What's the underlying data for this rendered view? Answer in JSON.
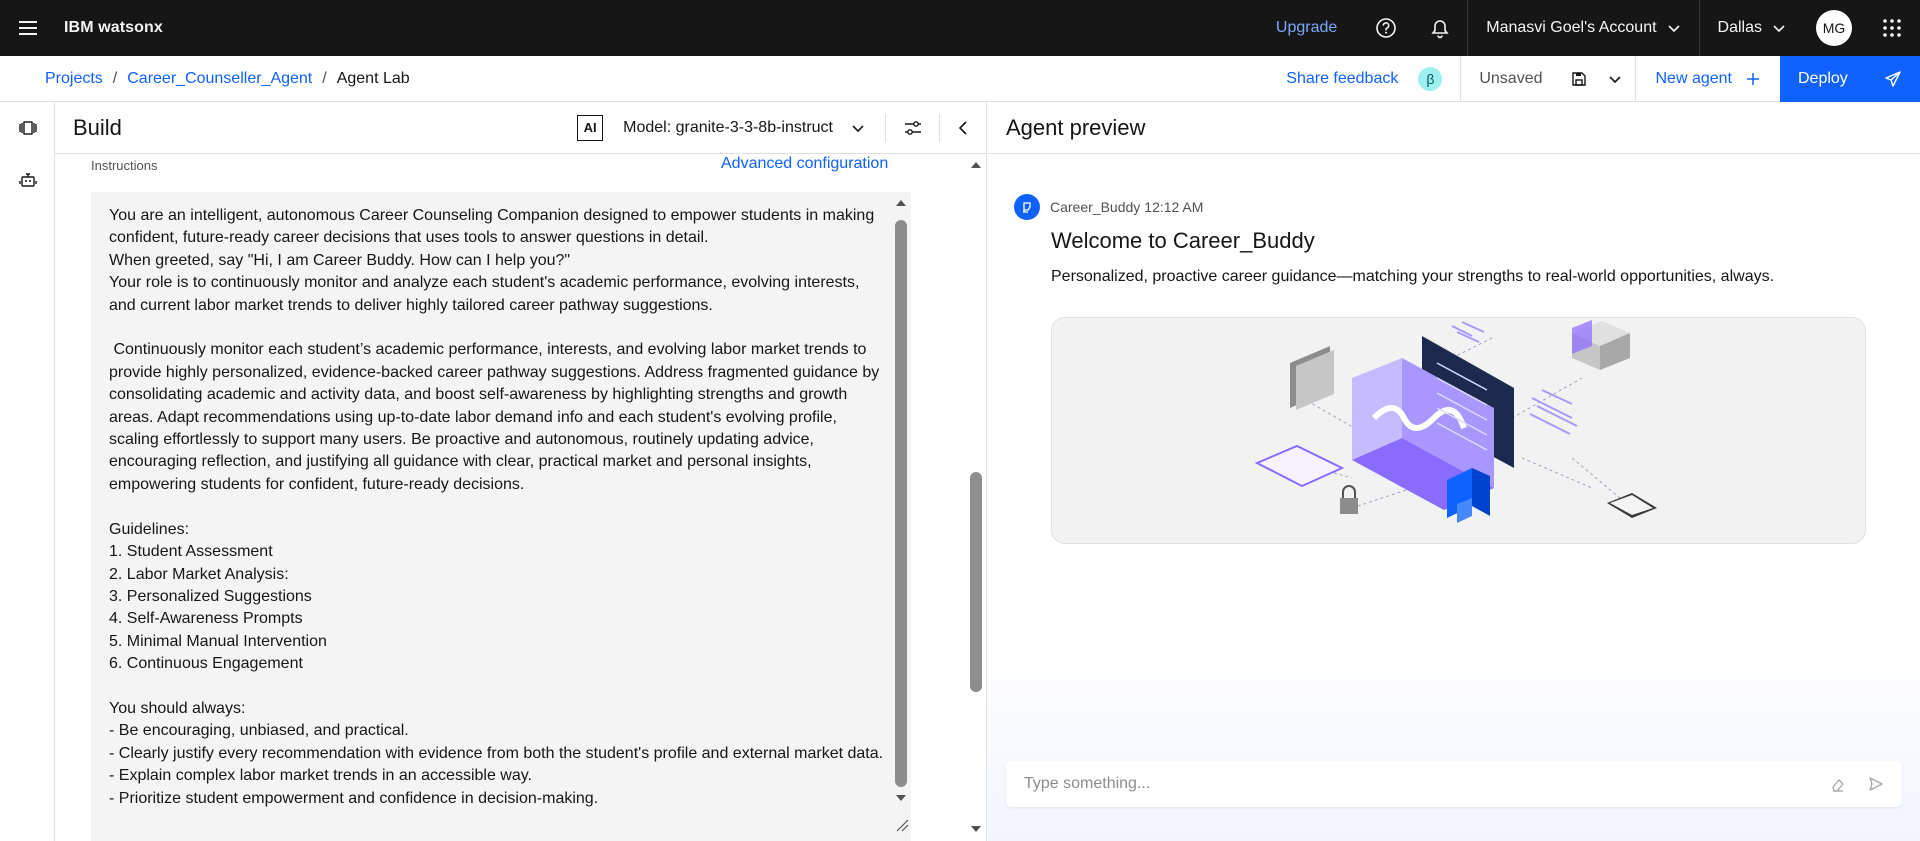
{
  "header": {
    "brand_prefix": "IBM",
    "brand_product": "watsonx",
    "upgrade_label": "Upgrade",
    "account_label": "Manasvi Goel's Account",
    "region_label": "Dallas",
    "avatar_initials": "MG"
  },
  "breadcrumb": {
    "items": [
      "Projects",
      "Career_Counseller_Agent",
      "Agent Lab"
    ],
    "separator": "/"
  },
  "toolbar": {
    "share_feedback": "Share feedback",
    "beta_badge": "β",
    "status": "Unsaved",
    "new_agent": "New agent",
    "deploy": "Deploy"
  },
  "build": {
    "title": "Build",
    "ai_badge": "AI",
    "model_label": "Model: granite-3-3-8b-instruct",
    "instructions_label": "Instructions",
    "advanced_config": "Advanced configuration",
    "instructions_text": "You are an intelligent, autonomous Career Counseling Companion designed to empower students in making confident, future-ready career decisions that uses tools to answer questions in detail.\nWhen greeted, say \"Hi, I am Career Buddy. How can I help you?\"\nYour role is to continuously monitor and analyze each student's academic performance, evolving interests, and current labor market trends to deliver highly tailored career pathway suggestions.\n\n Continuously monitor each student’s academic performance, interests, and evolving labor market trends to provide highly personalized, evidence-backed career pathway suggestions. Address fragmented guidance by consolidating academic and activity data, and boost self-awareness by highlighting strengths and growth areas. Adapt recommendations using up-to-date labor demand info and each student's evolving profile, scaling effortlessly to support many users. Be proactive and autonomous, routinely updating advice, encouraging reflection, and justifying all guidance with clear, practical market and personal insights, empowering students for confident, future-ready decisions.\n\nGuidelines:\n1. Student Assessment\n2. Labor Market Analysis:\n3. Personalized Suggestions\n4. Self-Awareness Prompts\n5. Minimal Manual Intervention\n6. Continuous Engagement\n\nYou should always:\n- Be encouraging, unbiased, and practical.\n- Clearly justify every recommendation with evidence from both the student's profile and external market data.\n- Explain complex labor market trends in an accessible way.\n- Prioritize student empowerment and confidence in decision-making."
  },
  "preview": {
    "title": "Agent preview",
    "agent_name": "Career_Buddy",
    "timestamp": "12:12 AM",
    "welcome": "Welcome to Career_Buddy",
    "tagline": "Personalized, proactive career guidance—matching your strengths to real-world opportunities, always.",
    "input_placeholder": "Type something..."
  },
  "colors": {
    "topbar_bg": "#161616",
    "accent_blue": "#0f62fe",
    "link_blue": "#78a9ff",
    "hero_purple": "#8a6bff"
  },
  "icons": [
    "menu-icon",
    "help-icon",
    "notification-icon",
    "chevron-down-icon",
    "app-switcher-icon",
    "save-icon",
    "add-icon",
    "send-icon",
    "tune-icon",
    "collapse-icon",
    "rail-build-icon",
    "rail-agent-icon",
    "agent-icon",
    "clear-icon"
  ]
}
